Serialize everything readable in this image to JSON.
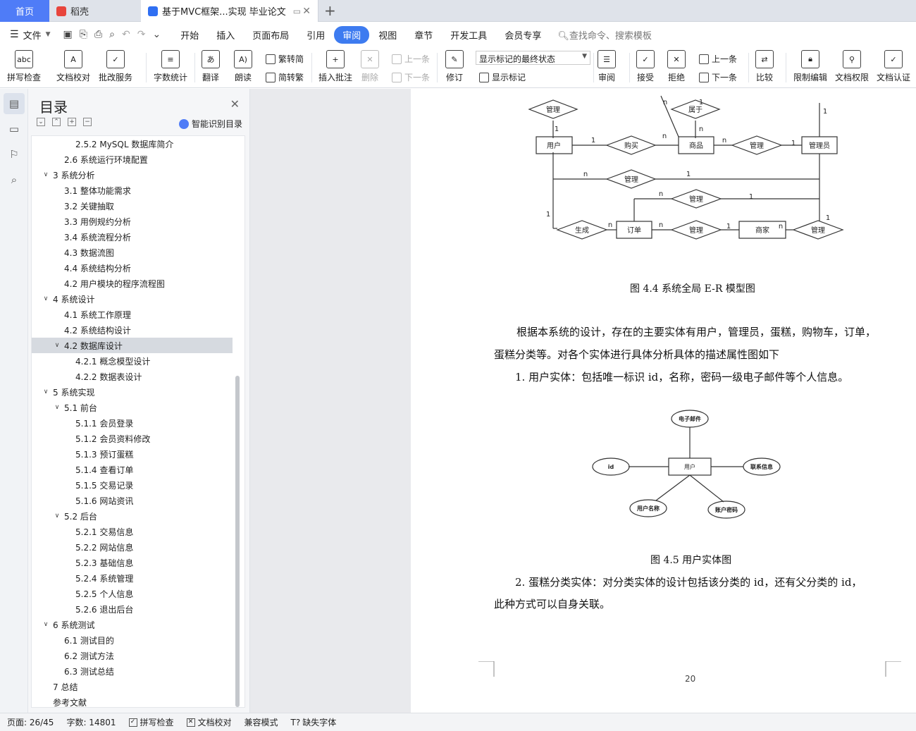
{
  "tabs": {
    "home": "首页",
    "daoke": "稻壳",
    "doc": "基于MVC框架...实现 毕业论文"
  },
  "menu": {
    "file": "文件",
    "tabs": [
      "开始",
      "插入",
      "页面布局",
      "引用",
      "审阅",
      "视图",
      "章节",
      "开发工具",
      "会员专享"
    ],
    "active_tab": "审阅",
    "search": "查找命令、搜索模板"
  },
  "ribbon": {
    "spell": "拼写检查",
    "doc_check": "文档校对",
    "batch": "批改服务",
    "wordcount": "字数统计",
    "translate": "翻译",
    "read": "朗读",
    "trad": "繁转简",
    "simp": "简转繁",
    "insert_comment": "插入批注",
    "delete": "删除",
    "prev": "上一条",
    "next": "下一条",
    "revise": "修订",
    "markup_state": "显示标记的最终状态",
    "show_markup": "显示标记",
    "review": "审阅",
    "accept": "接受",
    "reject": "拒绝",
    "prev2": "上一条",
    "next2": "下一条",
    "compare": "比较",
    "restrict": "限制编辑",
    "perm": "文档权限",
    "auth": "文档认证"
  },
  "outline": {
    "title": "目录",
    "smart": "智能识别目录",
    "items": [
      {
        "label": "2.5.2 MySQL 数据库简介",
        "level": 3,
        "chev": ""
      },
      {
        "label": "2.6  系统运行环境配置",
        "level": 2,
        "chev": ""
      },
      {
        "label": "3  系统分析",
        "level": 1,
        "chev": "v"
      },
      {
        "label": "3.1  整体功能需求",
        "level": 2,
        "chev": ""
      },
      {
        "label": "3.2  关键抽取",
        "level": 2,
        "chev": ""
      },
      {
        "label": "3.3  用例规约分析",
        "level": 2,
        "chev": ""
      },
      {
        "label": "3.4  系统流程分析",
        "level": 2,
        "chev": ""
      },
      {
        "label": "4.3  数据流图",
        "level": 2,
        "chev": ""
      },
      {
        "label": "4.4  系统结构分析",
        "level": 2,
        "chev": ""
      },
      {
        "label": "4.2  用户模块的程序流程图",
        "level": 2,
        "chev": ""
      },
      {
        "label": "4  系统设计",
        "level": 1,
        "chev": "v"
      },
      {
        "label": "4.1  系统工作原理",
        "level": 2,
        "chev": ""
      },
      {
        "label": "4.2  系统结构设计",
        "level": 2,
        "chev": ""
      },
      {
        "label": "4.2 数据库设计",
        "level": 2,
        "chev": "v",
        "selected": true
      },
      {
        "label": "4.2.1  概念模型设计",
        "level": 3,
        "chev": ""
      },
      {
        "label": "4.2.2  数据表设计",
        "level": 3,
        "chev": ""
      },
      {
        "label": "5  系统实现",
        "level": 1,
        "chev": "v"
      },
      {
        "label": "5.1  前台",
        "level": 2,
        "chev": "v"
      },
      {
        "label": "5.1.1  会员登录",
        "level": 3,
        "chev": ""
      },
      {
        "label": "5.1.2  会员资料修改",
        "level": 3,
        "chev": ""
      },
      {
        "label": "5.1.3  预订蛋糕",
        "level": 3,
        "chev": ""
      },
      {
        "label": "5.1.4  查看订单",
        "level": 3,
        "chev": ""
      },
      {
        "label": "5.1.5  交易记录",
        "level": 3,
        "chev": ""
      },
      {
        "label": "5.1.6  网站资讯",
        "level": 3,
        "chev": ""
      },
      {
        "label": "5.2  后台",
        "level": 2,
        "chev": "v"
      },
      {
        "label": "5.2.1  交易信息",
        "level": 3,
        "chev": ""
      },
      {
        "label": "5.2.2  网站信息",
        "level": 3,
        "chev": ""
      },
      {
        "label": "5.2.3  基础信息",
        "level": 3,
        "chev": ""
      },
      {
        "label": "5.2.4  系统管理",
        "level": 3,
        "chev": ""
      },
      {
        "label": "5.2.5  个人信息",
        "level": 3,
        "chev": ""
      },
      {
        "label": "5.2.6  退出后台",
        "level": 3,
        "chev": ""
      },
      {
        "label": "6  系统测试",
        "level": 1,
        "chev": "v"
      },
      {
        "label": "6.1  测试目的",
        "level": 2,
        "chev": ""
      },
      {
        "label": "6.2  测试方法",
        "level": 2,
        "chev": ""
      },
      {
        "label": "6.3  测试总结",
        "level": 2,
        "chev": ""
      },
      {
        "label": "7  总结",
        "level": 1,
        "chev": ""
      },
      {
        "label": "参考文献",
        "level": 1,
        "chev": ""
      }
    ]
  },
  "page": {
    "er_labels": {
      "user": "用户",
      "goods": "商品",
      "admin": "管理员",
      "order": "订单",
      "merchant": "商家",
      "buy": "购买",
      "manage": "管理",
      "belong": "属于",
      "generate": "生成",
      "one": "1",
      "n": "n"
    },
    "caption1": "图 4.4  系统全局 E-R 模型图",
    "para1": "根据本系统的设计，存在的主要实体有用户，管理员，蛋糕，购物车，订单，",
    "para1b": "蛋糕分类等。对各个实体进行具体分析具体的描述属性图如下",
    "item1": "1.   用户实体：包括唯一标识 id，名称，密码一级电子邮件等个人信息。",
    "user_attrs": {
      "email": "电子邮件",
      "id": "id",
      "user": "用户",
      "contact": "联系信息",
      "username": "用户名称",
      "password": "账户密码"
    },
    "caption2": "图 4.5  用户实体图",
    "item2": "2.   蛋糕分类实体：对分类实体的设计包括该分类的 id，还有父分类的 id，",
    "item2b": "此种方式可以自身关联。",
    "page_number": "20"
  },
  "status": {
    "page": "页面: 26/45",
    "words": "字数: 14801",
    "spell": "拼写检查",
    "doc_check": "文档校对",
    "compat": "兼容模式",
    "font": "缺失字体"
  }
}
